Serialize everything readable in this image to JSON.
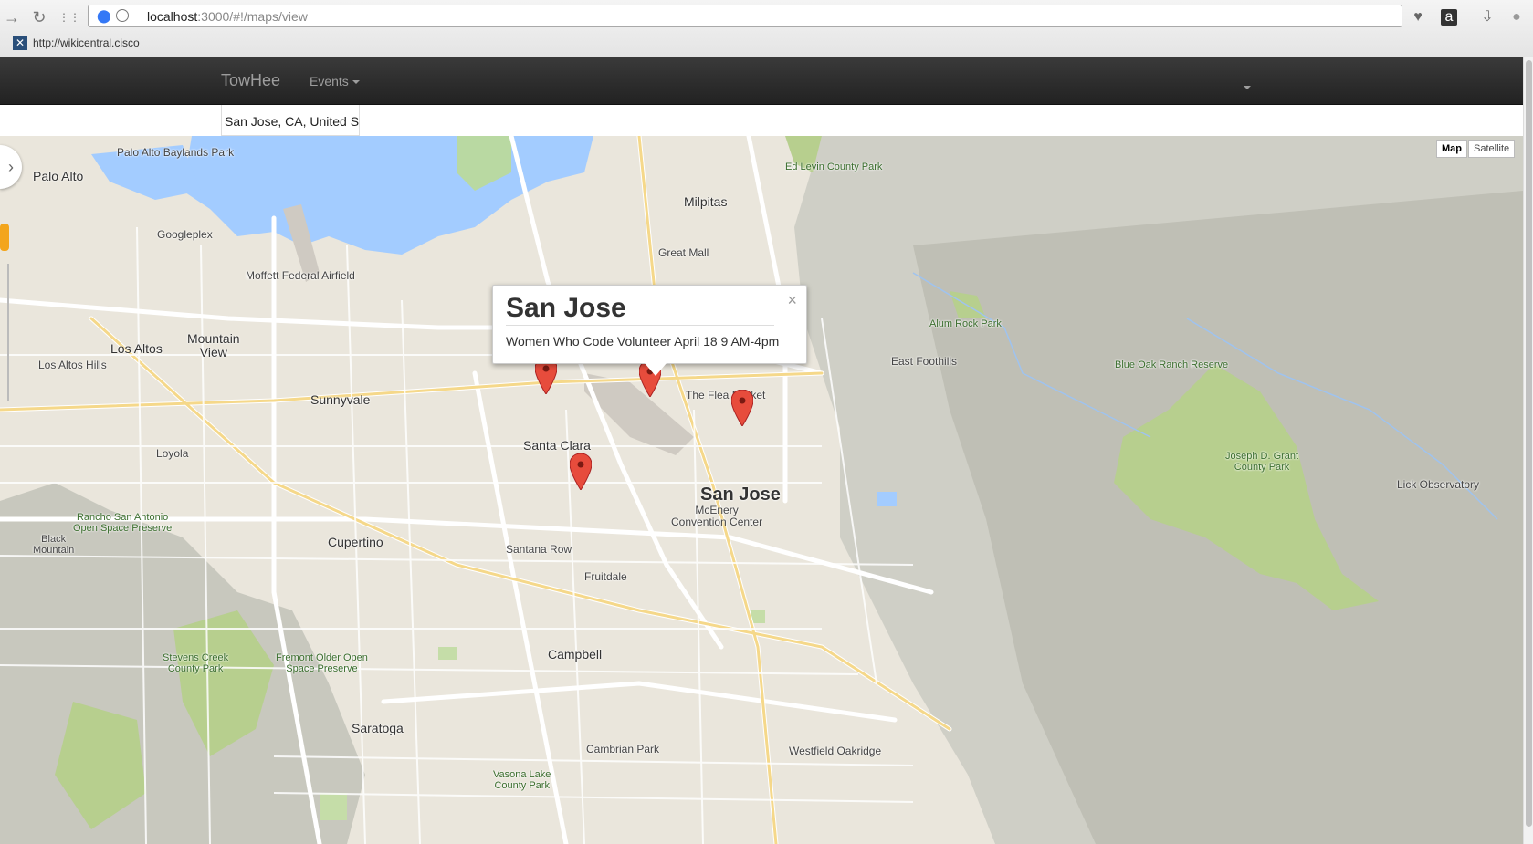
{
  "browser": {
    "url_host": "localhost",
    "url_path": ":3000/#!/maps/view",
    "bookmark": "http://wikicentral.cisco",
    "back_glyph": "→",
    "reload_glyph": "↻",
    "apps_glyph": "⋮⋮",
    "heart_glyph": "♥",
    "amazon_glyph": "a",
    "download_glyph": "⇩",
    "profile_glyph": "●"
  },
  "navbar": {
    "brand": "TowHee",
    "events_label": "Events"
  },
  "search": {
    "location_value": "San Jose, CA, United S"
  },
  "map": {
    "type_buttons": [
      "Map",
      "Satellite"
    ],
    "active_type": "Map",
    "labels": {
      "palo_alto": "Palo Alto",
      "baylands": "Palo Alto Baylands Park",
      "milpitas": "Milpitas",
      "ed_levin": "Ed Levin County Park",
      "googleplex": "Googleplex",
      "moffett": "Moffett Federal Airfield",
      "great_mall": "Great Mall",
      "mountain_view": "Mountain\nView",
      "los_altos": "Los Altos",
      "los_altos_hills": "Los Altos Hills",
      "sunnyvale": "Sunnyvale",
      "alum_rock": "Alum Rock Park",
      "east_foothills": "East Foothills",
      "blue_oak": "Blue Oak Ranch Reserve",
      "flea_market": "The Flea Market",
      "santa_clara": "Santa Clara",
      "san_jose": "San Jose",
      "loyola": "Loyola",
      "joseph_grant": "Joseph D. Grant\nCounty Park",
      "lick": "Lick Observatory",
      "rancho": "Rancho San Antonio\nOpen Space Preserve",
      "cupertino": "Cupertino",
      "mcenery": "McEnery\nConvention Center",
      "santana_row": "Santana Row",
      "fruitdale": "Fruitdale",
      "stevens_creek": "Stevens Creek\nCounty Park",
      "fremont_older": "Fremont Older Open\nSpace Preserve",
      "campbell": "Campbell",
      "saratoga": "Saratoga",
      "cambrian_park": "Cambrian Park",
      "westfield": "Westfield Oakridge",
      "vasona": "Vasona Lake\nCounty Park",
      "black_mountain": "Black\nMountain"
    }
  },
  "infowindow": {
    "title": "San Jose",
    "body": "Women Who Code Volunteer April 18 9 AM-4pm",
    "close": "×"
  },
  "colors": {
    "navbar": "#222222",
    "water": "#a3ccff",
    "land": "#eae6dc",
    "park": "#b7cf8e",
    "marker": "#e74c3c"
  },
  "markers": [
    {
      "lat": 37.36,
      "lng": -121.97
    },
    {
      "lat": 37.37,
      "lng": -121.93
    },
    {
      "lat": 37.35,
      "lng": -121.93
    },
    {
      "lat": 37.34,
      "lng": -121.87
    },
    {
      "lat": 37.31,
      "lng": -121.96
    }
  ]
}
